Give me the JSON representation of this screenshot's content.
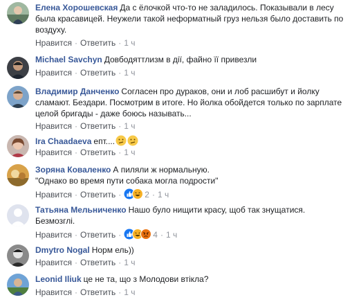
{
  "comments": [
    {
      "author": "Елена Хорошевская",
      "text": "Да с ёлочкой что-то не заладилось. Показывали в лесу была красавицей. Неужели такой неформатный груз нельзя было доставить по воздуху.",
      "like": "Нравится",
      "reply": "Ответить",
      "time": "1 ч"
    },
    {
      "author": "Michael Savchyn",
      "text": "Довбодяттлизм в дії, файно її привезли",
      "like": "Нравится",
      "reply": "Ответить",
      "time": "1 ч"
    },
    {
      "author": "Владимир Данченко",
      "text": "Согласен про дураков, они и лоб расшибут и йолку сламают. Бездари. Посмотрим в итоге. Но йолка обойдется только по зарплате целой бригады - даже боюсь называть...",
      "like": "Нравится",
      "reply": "Ответить",
      "time": "1 ч"
    },
    {
      "author": "Ira Chaadaeva",
      "text": "епт....",
      "emoji": "confused-face-emoji",
      "like": "Нравится",
      "reply": "Ответить",
      "time": "1 ч"
    },
    {
      "author": "Зоряна Коваленко",
      "text": "А пиляли ж нормальную.\n\"Однако во время пути собака могла подрости\"",
      "like": "Нравится",
      "reply": "Ответить",
      "reaction_icons": [
        "like-reaction-icon",
        "haha-reaction-icon"
      ],
      "reaction_count": "2",
      "time": "1 ч"
    },
    {
      "author": "Татьяна Мельниченко",
      "text": "Нашо було нищити красу, щоб так знущатися.\nБезмозглі.",
      "like": "Нравится",
      "reply": "Ответить",
      "reaction_icons": [
        "like-reaction-icon",
        "haha-reaction-icon",
        "angry-reaction-icon"
      ],
      "reaction_count": "4",
      "time": "1 ч"
    },
    {
      "author": "Dmytro Nogal",
      "text": "Норм ель))",
      "like": "Нравится",
      "reply": "Ответить",
      "time": "1 ч"
    },
    {
      "author": "Leonid Iliuk",
      "text": "це не та, що з Молодови втікла?",
      "like": "Нравится",
      "reply": "Ответить",
      "time": "1 ч"
    }
  ],
  "colors": {
    "author": "#385898",
    "text": "#1c1e21",
    "meta": "#90949c",
    "like_blue": "#1877f2",
    "haha_yellow": "#f7b125",
    "angry_orange": "#e9710f"
  }
}
